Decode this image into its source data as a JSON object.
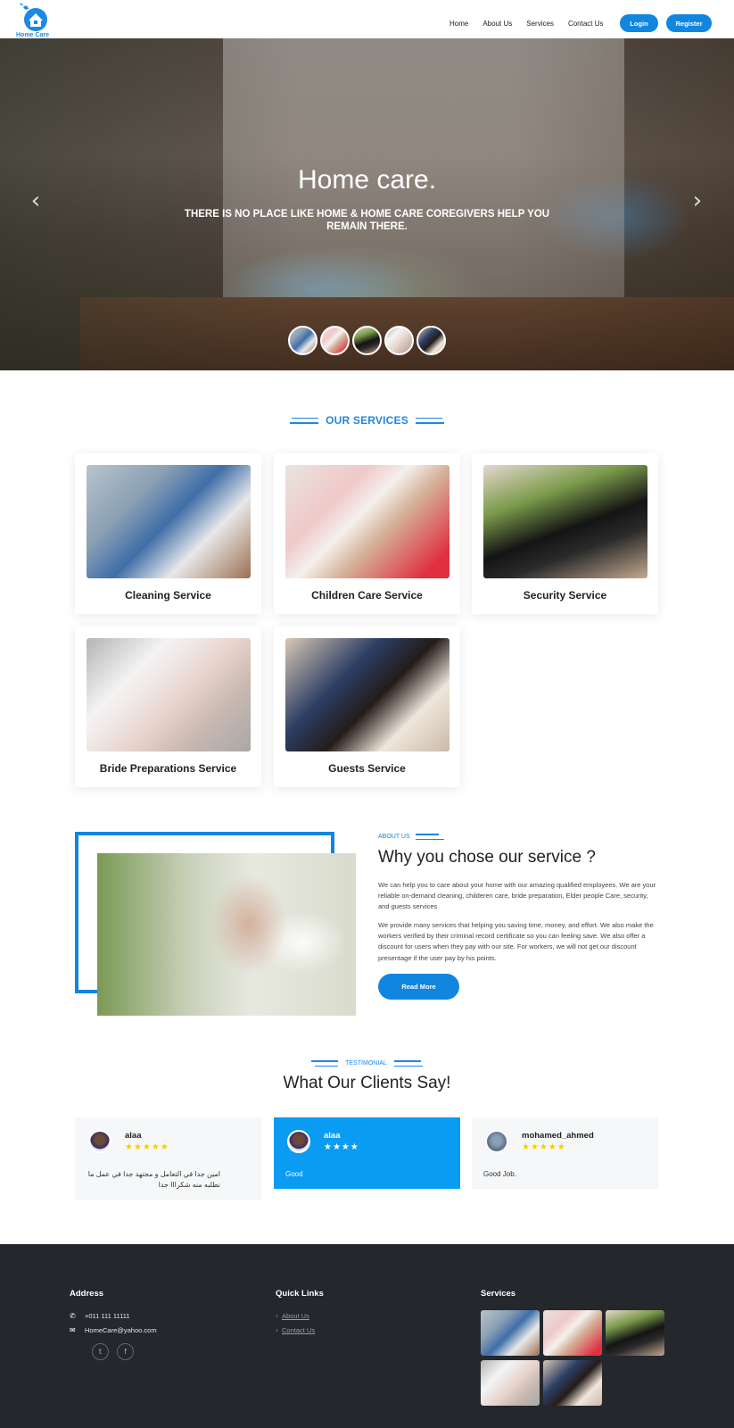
{
  "brand": {
    "name": "Home Care",
    "accent": "#1186df"
  },
  "nav": {
    "links": [
      "Home",
      "About Us",
      "Services",
      "Contact Us"
    ],
    "login": "Login",
    "register": "Register"
  },
  "hero": {
    "title": "Home care.",
    "subtitle": "THERE IS NO PLACE LIKE HOME & HOME CARE COREGIVERS HELP YOU REMAIN THERE.",
    "prev_icon": "chevron-left-icon",
    "next_icon": "chevron-right-icon",
    "slide_count": 5
  },
  "services": {
    "heading": "OUR SERVICES",
    "items": [
      {
        "label": "Cleaning Service"
      },
      {
        "label": "Children Care Service"
      },
      {
        "label": "Security Service"
      },
      {
        "label": "Bride Preparations Service"
      },
      {
        "label": "Guests Service"
      }
    ]
  },
  "about": {
    "kicker": "ABOUT US",
    "title": "Why you chose our service ?",
    "p1": "We can help you to care about your home with our amazing qualified employees. We are your reliable on-demand cleaning, childeren care, bride preparation, Elder people Care, security, and guests services",
    "p2": "We provide many services that helping you saving time, money, and effort. We also make the workers verified by their criminal record certificate so you can feeling save. We also offer a discount for users when they pay with our site. For workers, we will not get our discount presentage if the user pay by his points.",
    "button": "Read More"
  },
  "testimonials": {
    "kicker": "TESTIMONIAL",
    "title": "What Our Clients Say!",
    "items": [
      {
        "name": "alaa",
        "stars": "★★★★★",
        "rating": 5,
        "text": "امين جدا في التعامل و مجتهد جدا في عمل ما نطلبه منه شكرااا جدا"
      },
      {
        "name": "alaa",
        "stars": "★★★★",
        "rating": 4,
        "text": "Good"
      },
      {
        "name": "mohamed_ahmed",
        "stars": "★★★★★",
        "rating": 5,
        "text": "Good Job."
      }
    ]
  },
  "footer": {
    "address_heading": "Address",
    "phone": "+011 111 11111",
    "email": "HomeCare@yahoo.com",
    "quick_links_heading": "Quick Links",
    "quick_links": [
      "About Us",
      "Contact Us"
    ],
    "services_heading": "Services",
    "social": [
      "twitter-icon",
      "facebook-icon"
    ]
  }
}
